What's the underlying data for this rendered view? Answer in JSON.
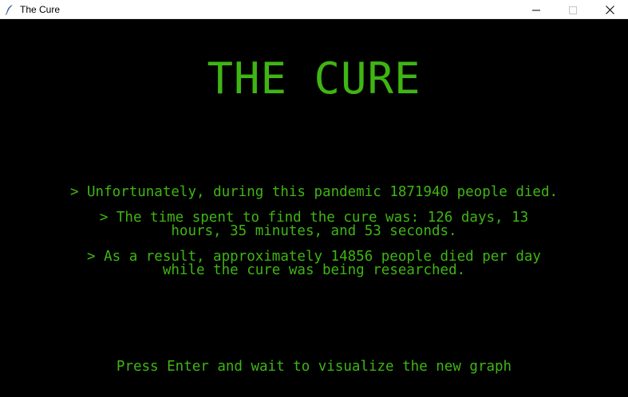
{
  "window": {
    "title": "The Cure",
    "minimize_glyph": "—",
    "maximize_glyph": "☐",
    "close_glyph": "✕"
  },
  "icons": {
    "app": "feather-icon",
    "minimize": "minimize-icon",
    "maximize": "maximize-icon",
    "close": "close-icon"
  },
  "colors": {
    "background": "#000000",
    "text": "#3fb514"
  },
  "main": {
    "title": "THE CURE",
    "lines": [
      "> Unfortunately, during this pandemic 1871940 people died.",
      "> The time spent to find the cure was: 126 days, 13\nhours, 35 minutes, and 53 seconds.",
      "> As a result, approximately 14856 people died per day\nwhile the cure was being researched."
    ],
    "prompt": "Press Enter and wait to visualize the new graph"
  }
}
